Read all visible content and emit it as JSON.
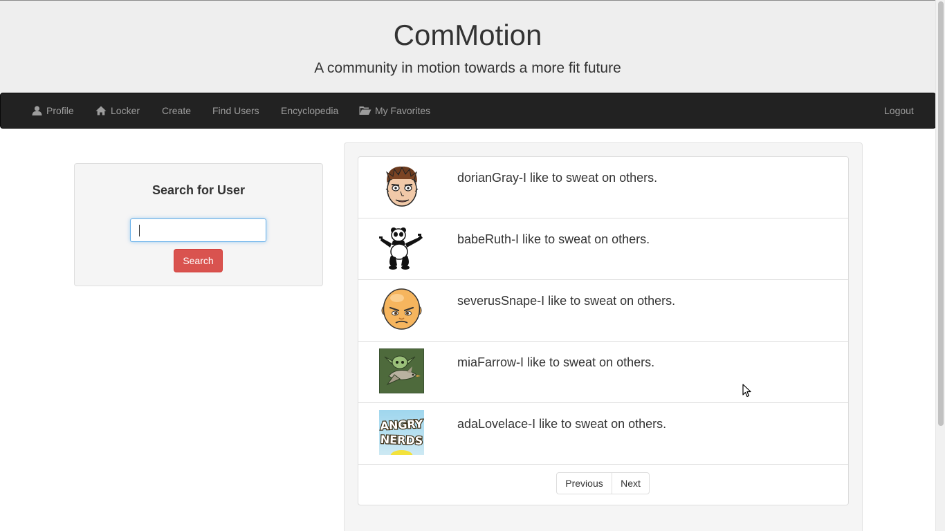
{
  "header": {
    "title": "ComMotion",
    "tagline": "A community in motion towards a more fit future"
  },
  "nav": {
    "items": [
      {
        "label": "Profile",
        "icon": "user-icon"
      },
      {
        "label": "Locker",
        "icon": "home-icon"
      },
      {
        "label": "Create"
      },
      {
        "label": "Find Users"
      },
      {
        "label": "Encyclopedia"
      },
      {
        "label": "My Favorites",
        "icon": "folder-open-icon"
      }
    ],
    "logout": "Logout"
  },
  "search": {
    "title": "Search for User",
    "input_value": "",
    "button_label": "Search"
  },
  "users": [
    {
      "text": "dorianGray-I like to sweat on others.",
      "avatar": "cartoon-man-avatar"
    },
    {
      "text": "babeRuth-I like to sweat on others.",
      "avatar": "panda-avatar"
    },
    {
      "text": "severusSnape-I like to sweat on others.",
      "avatar": "bald-face-avatar"
    },
    {
      "text": "miaFarrow-I like to sweat on others.",
      "avatar": "bird-avatar"
    },
    {
      "text": "adaLovelace-I like to sweat on others.",
      "avatar": "angry-nerds-avatar"
    }
  ],
  "angry_nerds_logo_text": "ANGRY NERDS",
  "pagination": {
    "previous": "Previous",
    "next": "Next"
  },
  "colors": {
    "navbar": "#222222",
    "nav_text": "#9d9d9d",
    "search_button": "#d9534f",
    "focus": "#66afe9"
  }
}
